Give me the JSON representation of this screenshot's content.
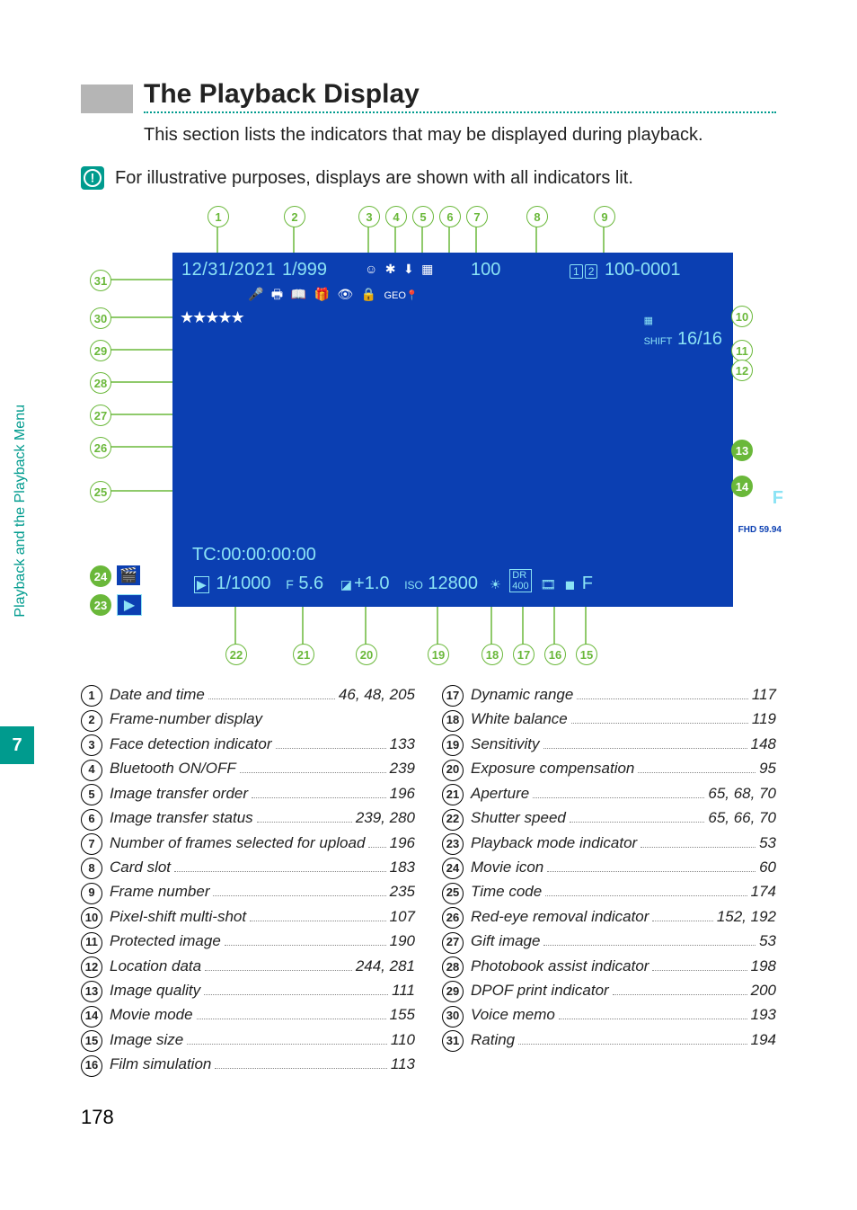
{
  "side": {
    "label": "Playback and the Playback Menu",
    "chapter": "7"
  },
  "heading": "The Playback Display",
  "intro": "This section lists the indicators that may be displayed during playback.",
  "note": "For illustrative purposes, displays are shown with all indicators lit.",
  "display": {
    "date": "12/31/2021",
    "frame_display": "1/999",
    "top100": "100",
    "frame_number": "100-0001",
    "slot1": "1",
    "slot2": "2",
    "pixel_shift": "16/16",
    "f_quality": "F",
    "movie_mode": "FHD\n59.94",
    "tc": "TC:00:00:00:00",
    "shutter": "1/1000",
    "aperture": "5.6",
    "exp_comp": "+1.0",
    "iso": "12800",
    "size_end": "F",
    "stars": "★★★★★"
  },
  "callouts_top": [
    "1",
    "2",
    "3",
    "4",
    "5",
    "6",
    "7",
    "8",
    "9"
  ],
  "callouts_left": [
    "31",
    "30",
    "29",
    "28",
    "27",
    "26",
    "25"
  ],
  "callouts_icons_left": [
    "24",
    "23"
  ],
  "callouts_right": [
    "10",
    "11",
    "12",
    "13",
    "14"
  ],
  "callouts_bottom": [
    "22",
    "21",
    "20",
    "19",
    "18",
    "17",
    "16",
    "15"
  ],
  "legend_left": [
    {
      "n": "1",
      "label": "Date and time",
      "page": "46, 48, 205"
    },
    {
      "n": "2",
      "label": "Frame-number display",
      "page": ""
    },
    {
      "n": "3",
      "label": "Face detection indicator",
      "page": "133"
    },
    {
      "n": "4",
      "label": "Bluetooth ON/OFF",
      "page": "239"
    },
    {
      "n": "5",
      "label": "Image transfer order",
      "page": "196"
    },
    {
      "n": "6",
      "label": "Image transfer status",
      "page": "239, 280"
    },
    {
      "n": "7",
      "label": "Number of frames selected for upload",
      "page": "196"
    },
    {
      "n": "8",
      "label": "Card slot",
      "page": "183"
    },
    {
      "n": "9",
      "label": "Frame number",
      "page": "235"
    },
    {
      "n": "10",
      "label": "Pixel-shift multi-shot",
      "page": "107"
    },
    {
      "n": "11",
      "label": "Protected image",
      "page": "190"
    },
    {
      "n": "12",
      "label": "Location data",
      "page": "244, 281"
    },
    {
      "n": "13",
      "label": "Image quality",
      "page": "111"
    },
    {
      "n": "14",
      "label": "Movie mode",
      "page": "155"
    },
    {
      "n": "15",
      "label": "Image size",
      "page": "110"
    },
    {
      "n": "16",
      "label": "Film simulation",
      "page": "113"
    }
  ],
  "legend_right": [
    {
      "n": "17",
      "label": "Dynamic range",
      "page": "117"
    },
    {
      "n": "18",
      "label": "White balance",
      "page": "119"
    },
    {
      "n": "19",
      "label": "Sensitivity",
      "page": "148"
    },
    {
      "n": "20",
      "label": "Exposure compensation",
      "page": "95"
    },
    {
      "n": "21",
      "label": "Aperture",
      "page": "65, 68, 70"
    },
    {
      "n": "22",
      "label": "Shutter speed",
      "page": "65, 66, 70"
    },
    {
      "n": "23",
      "label": "Playback mode indicator",
      "page": "53"
    },
    {
      "n": "24",
      "label": "Movie icon",
      "page": "60"
    },
    {
      "n": "25",
      "label": "Time code",
      "page": "174"
    },
    {
      "n": "26",
      "label": "Red-eye removal indicator",
      "page": "152, 192"
    },
    {
      "n": "27",
      "label": "Gift image",
      "page": "53"
    },
    {
      "n": "28",
      "label": "Photobook assist indicator",
      "page": "198"
    },
    {
      "n": "29",
      "label": "DPOF print indicator",
      "page": "200"
    },
    {
      "n": "30",
      "label": "Voice memo",
      "page": "193"
    },
    {
      "n": "31",
      "label": "Rating",
      "page": "194"
    }
  ],
  "page_number": "178"
}
